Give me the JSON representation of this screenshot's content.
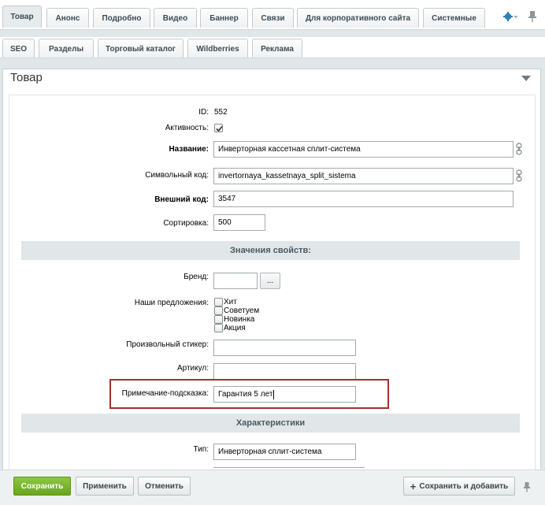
{
  "tabs_row1": [
    "Товар",
    "Анонс",
    "Подробно",
    "Видео",
    "Баннер",
    "Связи",
    "Для корпоративного сайта",
    "Системные"
  ],
  "tabs_row2": [
    "SEO",
    "Разделы",
    "Торговый каталог",
    "Wildberries",
    "Реклама"
  ],
  "toolbar": {
    "settings_icon": "gear-icon",
    "pin_icon": "pin-icon",
    "dropdown_caret": "˅"
  },
  "panel": {
    "title": "Товар"
  },
  "fields": {
    "id": {
      "label": "ID:",
      "value": "552"
    },
    "active": {
      "label": "Активность:",
      "checked": true
    },
    "name": {
      "label": "Название:",
      "value": "Инверторная кассетная сплит-система"
    },
    "code": {
      "label": "Символьный код:",
      "value": "invertornaya_kassetnaya_split_sistema"
    },
    "external": {
      "label": "Внешний код:",
      "value": "3547"
    },
    "sort": {
      "label": "Сортировка:",
      "value": "500"
    }
  },
  "section_properties": "Значения свойств:",
  "props": {
    "brand": {
      "label": "Бренд:",
      "value": "",
      "button": "..."
    },
    "offers": {
      "label": "Наши предложения:",
      "options": [
        "Хит",
        "Советуем",
        "Новинка",
        "Акция"
      ]
    },
    "sticker": {
      "label": "Произвольный стикер:",
      "value": ""
    },
    "article": {
      "label": "Артикул:",
      "value": ""
    },
    "note": {
      "label": "Примечание-подсказка:",
      "value": "Гарантия 5 лет"
    }
  },
  "section_specs": "Характеристики",
  "specs": {
    "type": {
      "label": "Тип:",
      "value": "Инверторная сплит-система"
    }
  },
  "footer": {
    "save": "Сохранить",
    "apply": "Применить",
    "cancel": "Отменить",
    "save_add": "Сохранить и добавить",
    "save_add_icon": "+"
  },
  "colors": {
    "accent_green": "#6aa522",
    "highlight_border": "#a2302e",
    "panel_bg": "#e1e6e8"
  }
}
